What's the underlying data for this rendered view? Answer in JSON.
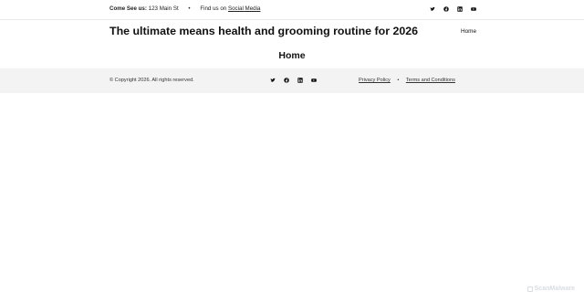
{
  "topbar": {
    "address_label": "Come See us:",
    "address_value": "123 Main St",
    "separator": "•",
    "find_us_text": "Find us on",
    "social_link": "Social Media",
    "icons": [
      "twitter-icon",
      "facebook-icon",
      "linkedin-icon",
      "youtube-icon"
    ]
  },
  "header": {
    "site_title": "The ultimate means health and grooming routine for 2026",
    "nav_home": "Home"
  },
  "main": {
    "page_title": "Home"
  },
  "footer": {
    "copyright": "© Copyright 2026. All rights reserved.",
    "privacy": "Privacy Policy",
    "separator": "•",
    "terms": "Terms and Conditions",
    "icons": [
      "twitter-icon",
      "facebook-icon",
      "linkedin-icon",
      "youtube-icon"
    ]
  },
  "watermark": {
    "text": "ScanMalware"
  }
}
